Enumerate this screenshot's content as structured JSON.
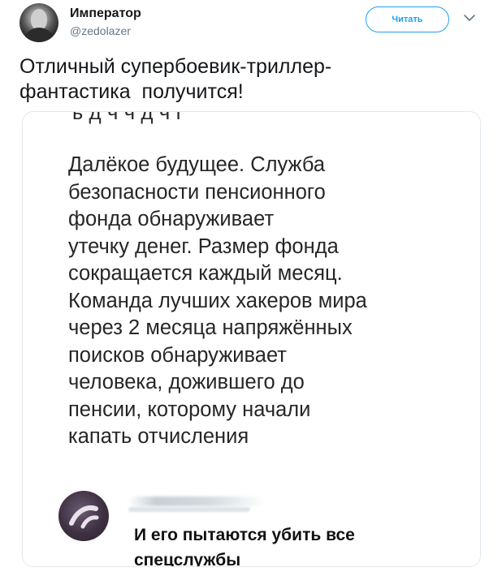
{
  "tweet": {
    "display_name": "Император",
    "handle": "@zedolazer",
    "follow_label": "Читать",
    "text": "Отличный супербоевик-триллер-\nфантастика  получится!"
  },
  "screenshot": {
    "cut_line": "ъ д ч ч д ч г",
    "story": "Далёкое будущее. Служба\nбезопасности пенсионного\nфонда обнаруживает\nутечку денег. Размер фонда\nсокращается каждый месяц.\nКоманда лучших хакеров мира\nчерез 2 месяца напряжённых\nпоисков обнаруживает\nчеловека, дожившего до\nпенсии, которому начали\nкапать отчисления",
    "comment": "И его пытаются убить все\nспецслужбы"
  },
  "colors": {
    "accent": "#1da1f2",
    "text": "#14171a",
    "muted": "#657786",
    "border": "#e1e8ed"
  },
  "icons": {
    "avatar": "user-avatar",
    "caret": "chevron-down-icon"
  }
}
